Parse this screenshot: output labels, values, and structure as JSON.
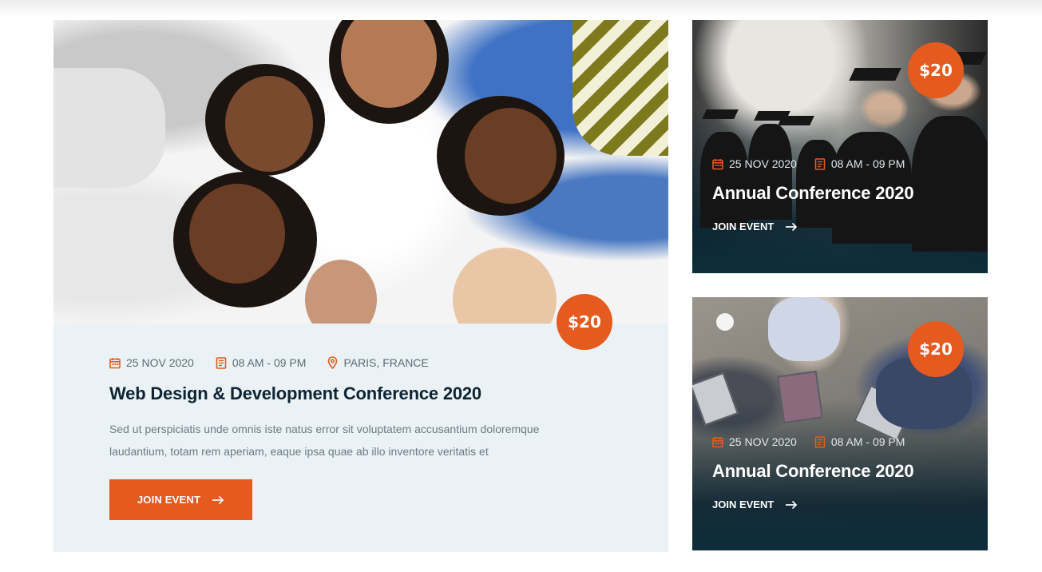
{
  "colors": {
    "accent": "#e55a1f",
    "heading": "#0e2433",
    "card_bg": "#eaf2f5",
    "overlay": "#0d2d3b"
  },
  "featured": {
    "price": "$20",
    "date": "25 NOV 2020",
    "time": "08 AM - 09 PM",
    "location": "PARIS, FRANCE",
    "title": "Web Design & Development Conference 2020",
    "description": "Sed ut perspiciatis unde omnis iste natus error sit voluptatem accusantium doloremque laudantium, totam rem aperiam, eaque ipsa quae ab illo inventore veritatis et",
    "button_label": "Join Event",
    "icons": {
      "date": "calendar-icon",
      "time": "clock-book-icon",
      "location": "map-pin-icon",
      "button": "arrow-right-icon"
    }
  },
  "side_events": [
    {
      "price": "$20",
      "date": "25 NOV 2020",
      "time": "08 AM - 09 PM",
      "title": "Annual Conference 2020",
      "link_label": "JOIN EVENT"
    },
    {
      "price": "$20",
      "date": "25 NOV 2020",
      "time": "08 AM - 09 PM",
      "title": "Annual Conference 2020",
      "link_label": "JOIN EVENT"
    }
  ]
}
